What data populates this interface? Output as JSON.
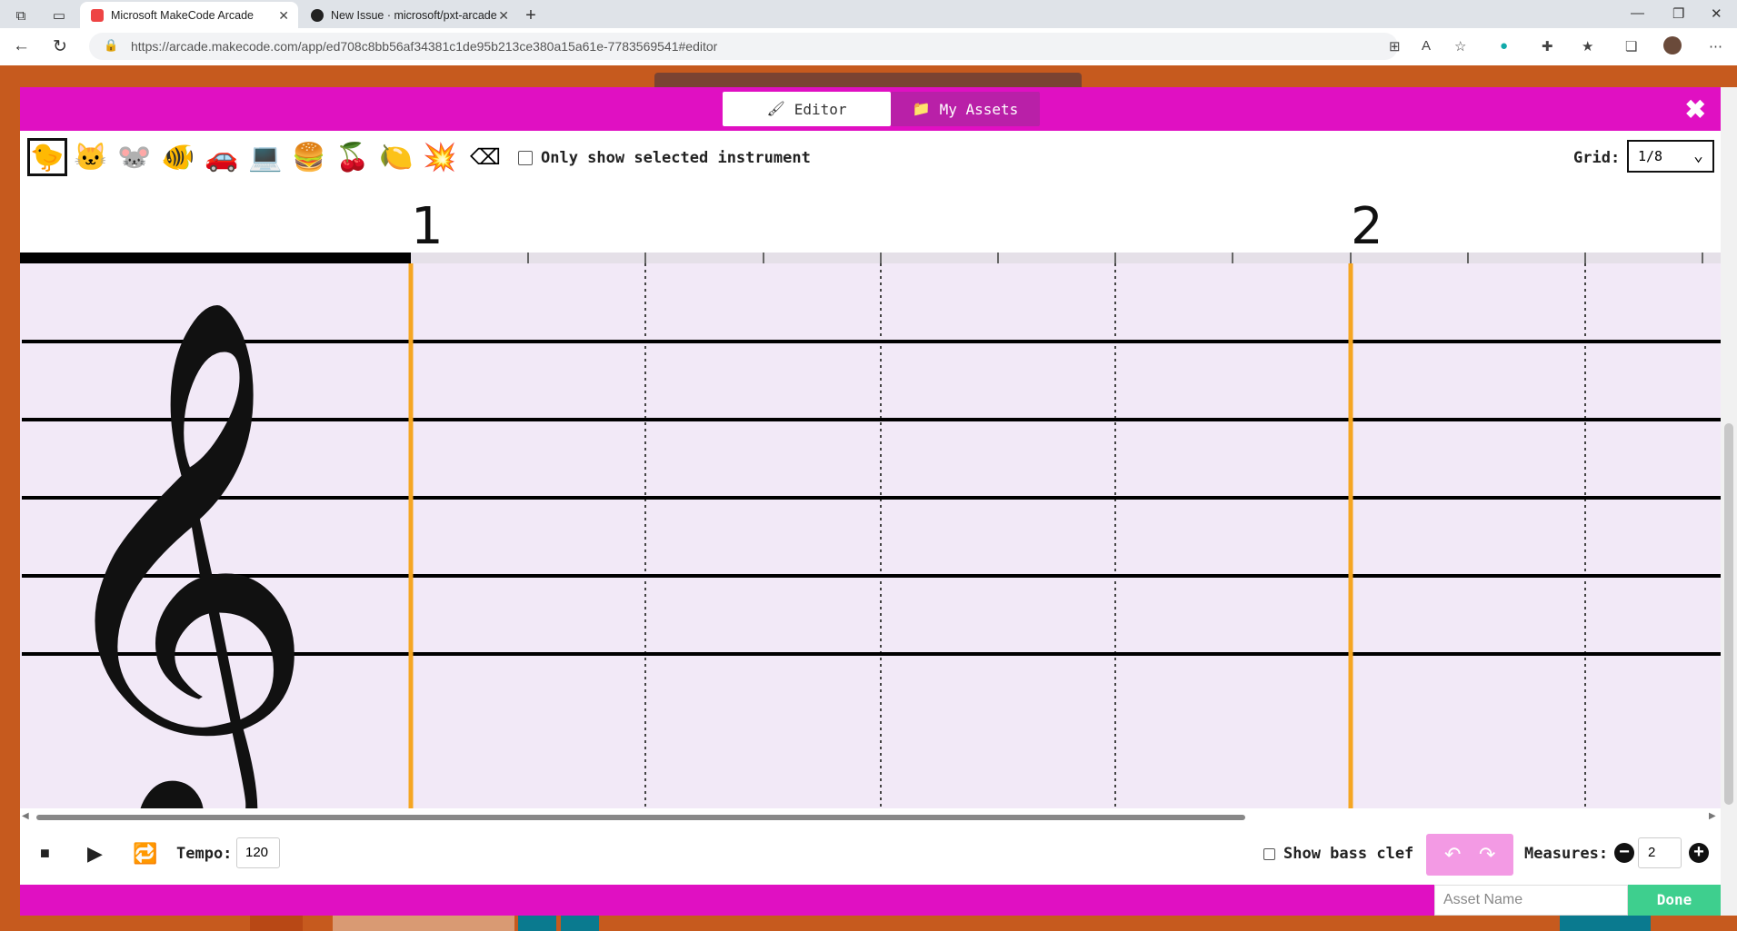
{
  "browser": {
    "tabs": [
      {
        "title": "Microsoft MakeCode Arcade",
        "active": true
      },
      {
        "title": "New Issue · microsoft/pxt-arcade",
        "active": false
      }
    ],
    "url": "https://arcade.makecode.com/app/ed708c8bb56af34381c1de95b213ce380a15a61e-7783569541#editor"
  },
  "modal": {
    "tabs": {
      "editor": "Editor",
      "my_assets": "My Assets"
    },
    "toolbar": {
      "instruments": [
        "duck",
        "cat",
        "mouse",
        "fish",
        "car",
        "computer",
        "burger",
        "cherries",
        "lemon",
        "explosion"
      ],
      "only_show_label": "Only show selected instrument",
      "grid_label": "Grid:",
      "grid_value": "1/8"
    },
    "measure_numbers": [
      "1",
      "2"
    ],
    "bottom": {
      "tempo_label": "Tempo:",
      "tempo_value": "120",
      "show_bass_clef": "Show bass clef",
      "measures_label": "Measures:",
      "measures_value": "2"
    },
    "footer": {
      "asset_name_placeholder": "Asset Name",
      "done": "Done"
    }
  },
  "colors": {
    "magenta": "#e010c2",
    "bar_orange": "#f5a623",
    "staff_bg": "#f2e9f7",
    "done_green": "#3ecf8e"
  }
}
